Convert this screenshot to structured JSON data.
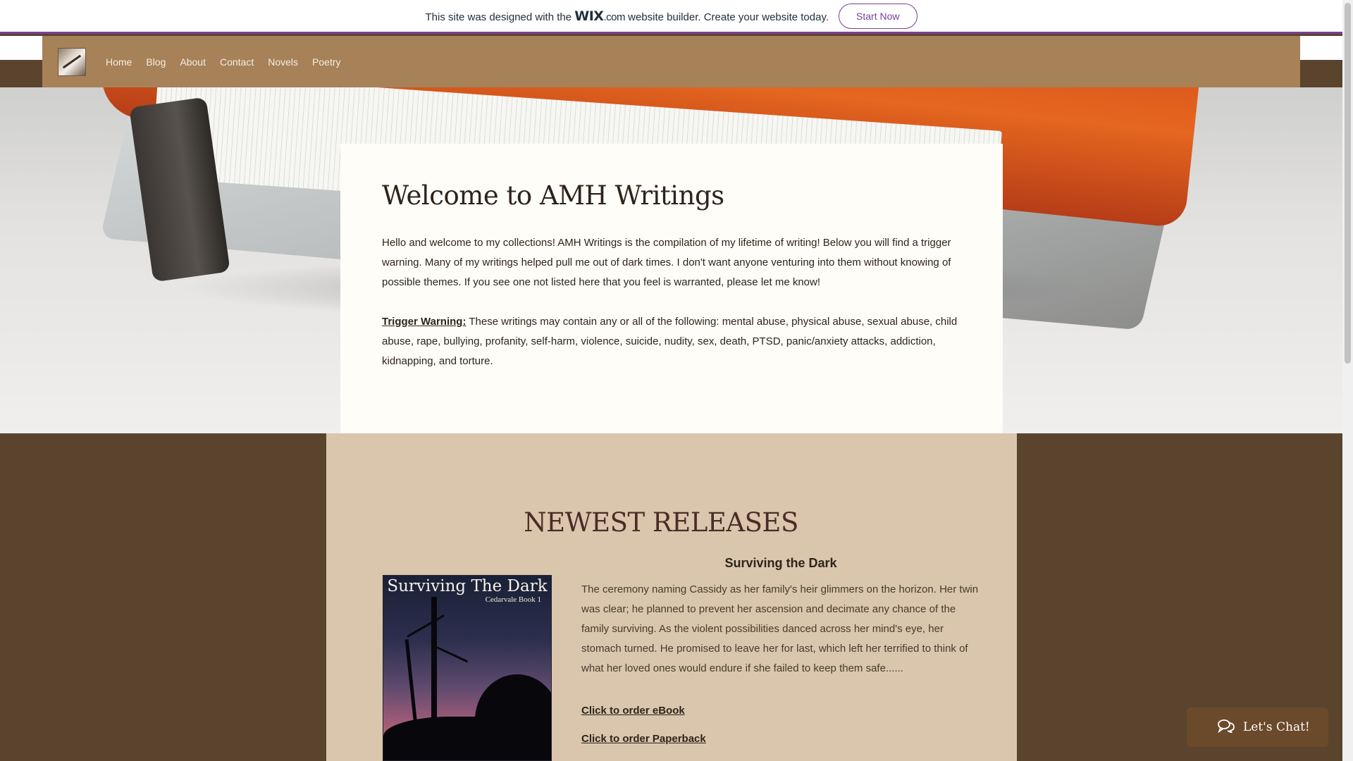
{
  "wix_banner": {
    "text_before": "This site was designed with the",
    "logo_wix": "WIX",
    "logo_com": ".com",
    "text_after": "website builder. Create your website today.",
    "cta": "Start Now"
  },
  "nav": {
    "items": [
      "Home",
      "Blog",
      "About",
      "Contact",
      "Novels",
      "Poetry"
    ]
  },
  "welcome": {
    "title": "Welcome to AMH Writings",
    "intro": "Hello and welcome to my collections! AMH Writings is the compilation of my lifetime of writing! Below you will find a trigger warning. Many of my writings helped pull me out of dark times. I don't want anyone venturing into them without knowing of possible themes.  If you see one not listed here that you feel is warranted, please let me know!",
    "trigger_label": "Trigger Warning:",
    "trigger_text": " These writings may contain any or all of the following: mental abuse, physical abuse, sexual abuse, child abuse, rape, bullying, profanity, self-harm, violence, suicide, nudity, sex, death, PTSD, panic/anxiety attacks, addiction, kidnapping, and torture."
  },
  "releases": {
    "title": "NEWEST RELEASES",
    "book_title": "Surviving the Dark",
    "cover_title": "Surviving The Dark",
    "cover_subtitle": "Cedarvale Book 1",
    "description": "The ceremony naming Cassidy as her family's heir glimmers on the horizon. Her twin was clear; he planned to prevent her ascension and decimate any chance of the family surviving. As the violent possibilities danced across her mind's eye, her stomach turned. He promised to leave her for last, which left her terrified to think of what her loved ones would endure if she failed to keep them safe......",
    "order_ebook": "Click to order eBook",
    "order_paperback": "Click to order Paperback"
  },
  "chat": {
    "label": "Let's Chat!",
    "icon": "chat-bubbles-icon"
  },
  "colors": {
    "wix_purple": "#7b3f97",
    "nav_bg": "#a78158",
    "page_bg": "#5a442d",
    "releases_bg": "#d9c6ad",
    "card_bg": "#fffdf8"
  }
}
